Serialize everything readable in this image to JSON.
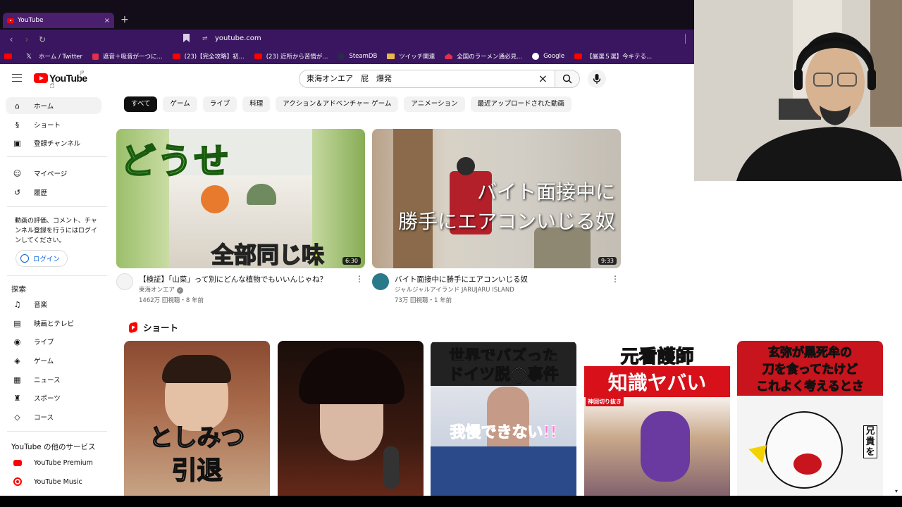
{
  "browser": {
    "tab_title": "YouTube",
    "tab_close": "×",
    "new_tab": "+",
    "url": "youtube.com",
    "nav": {
      "back": "‹",
      "forward": "›",
      "reload": "↻"
    },
    "site_icon": "⇌",
    "bookmarks": [
      {
        "label": "",
        "icon": "youtube-icon"
      },
      {
        "label": "ホーム / Twitter",
        "icon": "x-icon"
      },
      {
        "label": "遮音＋吸音が一つに...",
        "icon": "red-icon"
      },
      {
        "label": "(23)【完全攻略】初...",
        "icon": "youtube-icon"
      },
      {
        "label": "(23) 近所から苦情が...",
        "icon": "youtube-icon"
      },
      {
        "label": "SteamDB",
        "icon": "steam-icon"
      },
      {
        "label": "ツイッチ関連",
        "icon": "folder-icon"
      },
      {
        "label": "全国のラーメン通必見...",
        "icon": "house-icon"
      },
      {
        "label": "Google",
        "icon": "google-icon"
      },
      {
        "label": "【厳選５選】今キテる...",
        "icon": "youtube-icon"
      }
    ]
  },
  "header": {
    "logo_text": "YouTube",
    "logo_region": "JP",
    "search_value": "東海オンエア　屁　爆発",
    "clear_icon": "×"
  },
  "chips": [
    "すべて",
    "ゲーム",
    "ライブ",
    "料理",
    "アクション＆アドベンチャー ゲーム",
    "アニメーション",
    "最近アップロードされた動画"
  ],
  "sidebar": {
    "main": [
      {
        "label": "ホーム",
        "icon": "home-icon",
        "glyph": "⌂"
      },
      {
        "label": "ショート",
        "icon": "shorts-icon",
        "glyph": "§"
      },
      {
        "label": "登録チャンネル",
        "icon": "subscriptions-icon",
        "glyph": "▣"
      }
    ],
    "you": [
      {
        "label": "マイページ",
        "icon": "account-icon",
        "glyph": "☺"
      },
      {
        "label": "履歴",
        "icon": "history-icon",
        "glyph": "↺"
      }
    ],
    "signin_note": "動画の評価、コメント、チャンネル登録を行うにはログインしてください。",
    "login_label": "ログイン",
    "explore_heading": "探索",
    "explore": [
      {
        "label": "音楽",
        "icon": "music-icon",
        "glyph": "♫"
      },
      {
        "label": "映画とテレビ",
        "icon": "movies-icon",
        "glyph": "▤"
      },
      {
        "label": "ライブ",
        "icon": "live-icon",
        "glyph": "◉"
      },
      {
        "label": "ゲーム",
        "icon": "gaming-icon",
        "glyph": "◈"
      },
      {
        "label": "ニュース",
        "icon": "news-icon",
        "glyph": "▦"
      },
      {
        "label": "スポーツ",
        "icon": "trophy-icon",
        "glyph": "♜"
      },
      {
        "label": "コース",
        "icon": "courses-icon",
        "glyph": "◇"
      }
    ],
    "more_heading": "YouTube の他のサービス",
    "more": [
      {
        "label": "YouTube Premium",
        "icon": "youtube-premium-icon"
      },
      {
        "label": "YouTube Music",
        "icon": "youtube-music-icon"
      }
    ]
  },
  "videos": [
    {
      "title": "【検証】「山菜」って別にどんな植物でもいいんじゃね？",
      "channel": "東海オンエア",
      "verified": "✓",
      "stats": "1462万 回視聴・8 年前",
      "duration": "6:30",
      "thumb_text_top": "どうせ",
      "thumb_text_bottom": "全部同じ味",
      "avatar_color": "#f4f4f4"
    },
    {
      "title": "バイト面接中に勝手にエアコンいじる奴",
      "channel": "ジャルジャルアイランド JARUJARU ISLAND",
      "stats": "73万 回視聴・1 年前",
      "duration": "9:33",
      "thumb_text_line1": "バイト面接中に",
      "thumb_text_line2": "勝手にエアコンいじる奴",
      "avatar_color": "#2a7a8a"
    }
  ],
  "shorts": {
    "heading": "ショート",
    "items": [
      {
        "caption_line1": "としみつ",
        "caption_line2": "引退"
      },
      {
        "caption_line1": "",
        "caption_line2": ""
      },
      {
        "caption_line1": "世界でバズった",
        "caption_line2": "ドイツ脱◯事件",
        "caption_line3": "我慢できない!!"
      },
      {
        "caption_line1": "元看護師",
        "caption_line2": "知識ヤバい",
        "badge": "神回切り抜き"
      },
      {
        "caption_line1": "玄弥が黒死牟の",
        "caption_line2": "刀を食ってたけど",
        "caption_line3": "これよく考えるとさ",
        "side": "兄貴を"
      }
    ]
  }
}
